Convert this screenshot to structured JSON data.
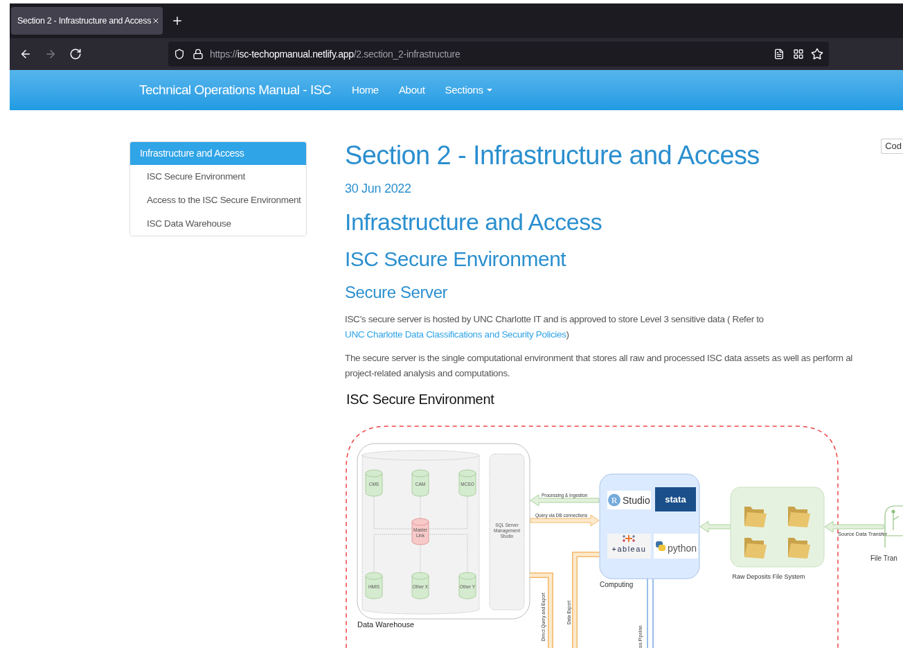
{
  "browser": {
    "tab": {
      "title": "Section 2 - Infrastructure and Access"
    },
    "nav_buttons": [
      {
        "kind": "back",
        "disabled": false
      },
      {
        "kind": "forward",
        "disabled": true
      },
      {
        "kind": "reload",
        "disabled": false
      }
    ],
    "url": {
      "scheme": "https://",
      "host": "isc-techopmanual.netlify.app",
      "path": "/2.section_2-infrastructure"
    }
  },
  "navbar": {
    "brand": "Technical Operations Manual - ISC",
    "links": [
      {
        "label": "Home",
        "dropdown": false
      },
      {
        "label": "About",
        "dropdown": false
      },
      {
        "label": "Sections",
        "dropdown": true
      }
    ]
  },
  "sidebar": {
    "items": [
      {
        "label": "Infrastructure and Access",
        "selected": true,
        "children": [
          {
            "label": "ISC Secure Environment",
            "selected": false
          },
          {
            "label": "Access to the ISC Secure Environment",
            "selected": false
          },
          {
            "label": "ISC Data Warehouse",
            "selected": false
          }
        ]
      }
    ]
  },
  "code_button": "Cod",
  "content": {
    "title": "Section 2 - Infrastructure and Access",
    "date": "30 Jun 2022",
    "h1": "Infrastructure and Access",
    "h2": "ISC Secure Environment",
    "h3": "Secure Server",
    "paragraphs": [
      {
        "parts": [
          {
            "text": "ISC’s secure server is hosted by UNC Charlotte IT and is approved to store Level 3 sensitive data ( Refer to ",
            "link": false
          },
          {
            "text": "UNC Charlotte Data Classifications and Security Policies",
            "link": true
          },
          {
            "text": ")",
            "link": false
          }
        ]
      },
      {
        "lines": [
          "The secure server is the single computational environment that stores all raw and processed ISC data assets as well as perform al",
          "project-related analysis and computations."
        ]
      }
    ]
  },
  "diagram": {
    "caption": "ISC Secure Environment",
    "data_warehouse": {
      "label": "Data Warehouse",
      "databases": [
        {
          "name": "CMS",
          "kind": "source"
        },
        {
          "name": "CAM",
          "kind": "source"
        },
        {
          "name": "MCSO",
          "kind": "source"
        },
        {
          "name": "Master Link",
          "kind": "hub"
        },
        {
          "name": "HMIS",
          "kind": "source"
        },
        {
          "name": "Other X",
          "kind": "source"
        },
        {
          "name": "Other Y",
          "kind": "source"
        }
      ]
    },
    "sql_tool": {
      "lines": [
        "SQL Server",
        "Management",
        "Studio"
      ]
    },
    "processing_arrow": "Processing & Ingestion",
    "query_arrow": "Query via DB connections",
    "direct_query_pipe": "Direct Query and Export",
    "data_export_pipe": "Data Export",
    "pipeline_label": "sis Pipeline",
    "computing": {
      "label": "Computing",
      "tools": [
        {
          "kind": "rstudio",
          "letter": "R",
          "name": "Studio"
        },
        {
          "kind": "stata",
          "name": "stata"
        },
        {
          "kind": "tableau",
          "name": "+ableau"
        },
        {
          "kind": "python",
          "name": "python"
        }
      ]
    },
    "raw_deposits": "Raw Deposits File System",
    "source_transfer": "Source Data Transfer",
    "file_transfer": "File Tran"
  }
}
